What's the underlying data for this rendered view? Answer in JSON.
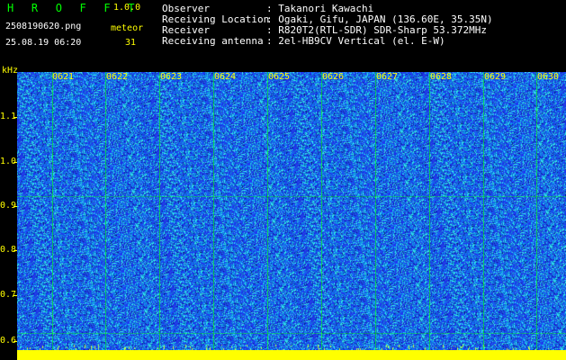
{
  "header": {
    "app_title": "H R O F F T",
    "app_version": "1.0.0",
    "filename": "2508190620.png",
    "meteor_label": "meteor",
    "timestamp": "25.08.19 06:20",
    "meteor_count": "31",
    "info": [
      {
        "label": "Observer",
        "value": ": Takanori Kawachi"
      },
      {
        "label": "Receiving Location",
        "value": ": Ogaki, Gifu, JAPAN (136.60E, 35.35N)"
      },
      {
        "label": "Receiver",
        "value": ": R820T2(RTL-SDR) SDR-Sharp 53.372MHz"
      },
      {
        "label": "Receiving antenna",
        "value": ": 2el-HB9CV Vertical (el. E-W)"
      }
    ]
  },
  "spectrogram": {
    "unit": "kHz",
    "y_ticks": [
      "1.1",
      "1.0",
      "0.9",
      "0.8",
      "0.7",
      "0.6"
    ],
    "x_ticks": [
      "0621",
      "0622",
      "0623",
      "0624",
      "0625",
      "0626",
      "0627",
      "0628",
      "0629",
      "0630"
    ],
    "colors": {
      "background": "#000000",
      "label": "#ffff00",
      "title": "#00ff00",
      "grid": "#00ff00",
      "spectrum_base": "#1f3cff",
      "spectrum_mid": "#1a9ce6",
      "spectrum_hot": "#2ef0e0",
      "waterfall_bar": "#ffff00"
    }
  }
}
